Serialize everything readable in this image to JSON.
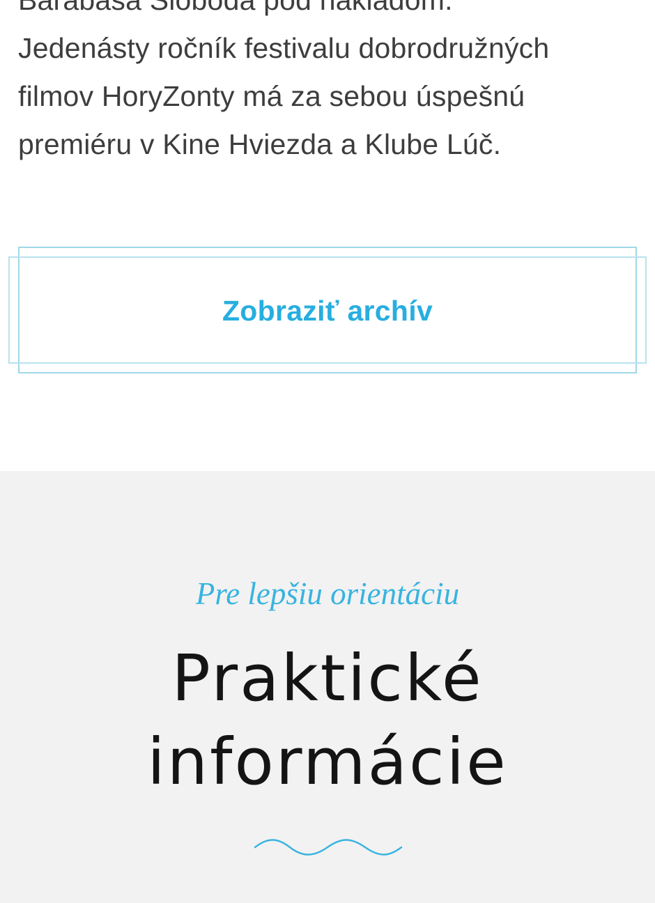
{
  "article": {
    "lines": [
      "Barabasa Sloboda pod nákladom.",
      "Jedenásty ročník festivalu dobrodružných",
      "filmov HoryZonty má za sebou úspešnú",
      "premiéru v Kine Hviezda a Klube Lúč."
    ]
  },
  "archive_button": {
    "label": "Zobraziť archív"
  },
  "practical_info": {
    "kicker": "Pre lepšiu orientáciu",
    "title_lines": [
      "Praktické",
      "informácie"
    ],
    "divider_icon": "wave-divider-icon"
  },
  "colors": {
    "accent": "#27aee0",
    "kicker": "#38b3e0",
    "button_border": "#9fd8e8",
    "body_text": "#3d3d3d",
    "title_text": "#141414",
    "section_background": "#f2f2f2"
  }
}
